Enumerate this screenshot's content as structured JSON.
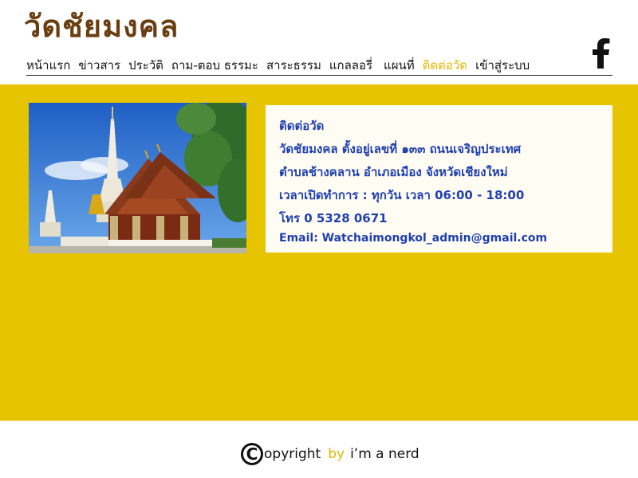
{
  "header": {
    "site_title": "วัดชัยมงคล",
    "nav": [
      {
        "label": "หน้าแรก"
      },
      {
        "label": "ข่าวสาร"
      },
      {
        "label": "ประวัติ"
      },
      {
        "label": "ถาม-ตอบ ธรรมะ"
      },
      {
        "label": "สาระธรรม"
      },
      {
        "label": "แกลลอรี่"
      },
      {
        "label": "แผนที่"
      },
      {
        "label": "ติดต่อวัด",
        "active": true
      },
      {
        "label": "เข้าสู่ระบบ"
      }
    ],
    "social_icon": "facebook-icon"
  },
  "contact": {
    "heading": "ติดต่อวัด",
    "address_line1": "วัดชัยมงคล ตั้งอยู่เลขที่ ๑๓๓ ถนนเจริญประเทศ",
    "address_line2": "ตำบลช้างคลาน อำเภอเมือง จังหวัดเชียงใหม่",
    "hours": "เวลาเปิดทำการ : ทุกวัน เวลา 06:00 - 18:00",
    "phone": "โทร  0 5328 0671",
    "email": "Email: Watchaimongkol_admin@gmail.com"
  },
  "footer": {
    "copyright_symbol": "C",
    "copyright_word": "opyright",
    "by_word": "by",
    "author": "i’m a nerd"
  },
  "colors": {
    "brand_brown": "#6b3e12",
    "band_yellow": "#e6c400",
    "active_nav": "#e3b800",
    "info_text": "#1f3fb0"
  }
}
